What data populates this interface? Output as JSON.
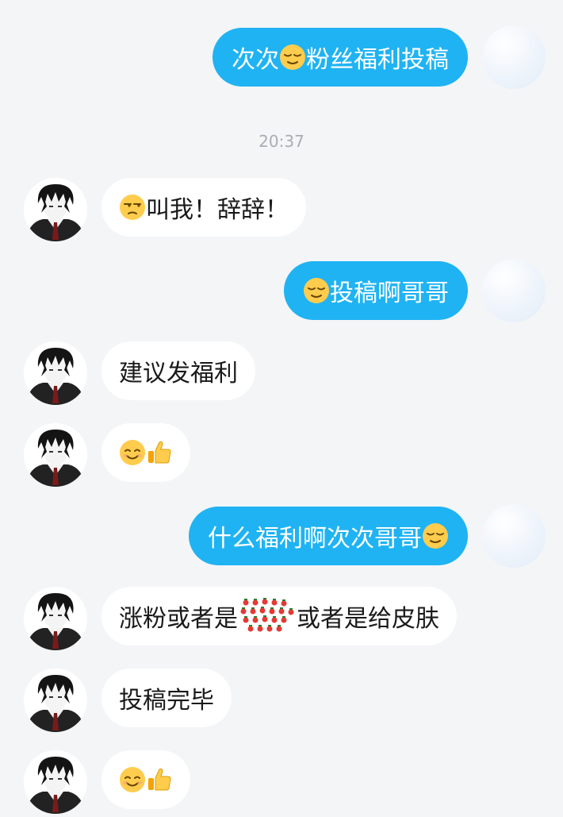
{
  "time_divider": "20:37",
  "colors": {
    "outgoing_bubble": "#1fb3f3",
    "incoming_bubble": "#ffffff",
    "background": "#f4f5f7",
    "timestamp": "#a9adb3"
  },
  "messages": [
    {
      "side": "right",
      "parts": [
        "次次",
        "relieved-emoji",
        "粉丝福利投稿"
      ]
    },
    {
      "side": "left",
      "parts": [
        "unamused-emoji",
        "叫我！辞辞！"
      ]
    },
    {
      "side": "right",
      "parts": [
        "relieved-emoji",
        "投稿啊哥哥"
      ]
    },
    {
      "side": "left",
      "parts": [
        "建议发福利"
      ]
    },
    {
      "side": "left",
      "parts": [
        "smiling-emoji",
        "thumbs-up-emoji"
      ]
    },
    {
      "side": "right",
      "parts": [
        "什么福利啊次次哥哥",
        "relieved-emoji"
      ]
    },
    {
      "side": "left",
      "parts": [
        "涨粉或者是",
        "strawberry-sticker",
        "或者是给皮肤"
      ]
    },
    {
      "side": "left",
      "parts": [
        "投稿完毕"
      ]
    },
    {
      "side": "left",
      "parts": [
        "smiling-emoji",
        "thumbs-up-emoji"
      ]
    }
  ],
  "m1": {
    "t1": "次次",
    "t2": "粉丝福利投稿"
  },
  "m2": {
    "t1": "叫我！辞辞！"
  },
  "m3": {
    "t1": "投稿啊哥哥"
  },
  "m4": {
    "t1": "建议发福利"
  },
  "m6": {
    "t1": "什么福利啊次次哥哥"
  },
  "m7": {
    "t1": "涨粉或者是",
    "t2": "或者是给皮肤"
  },
  "m8": {
    "t1": "投稿完毕"
  }
}
